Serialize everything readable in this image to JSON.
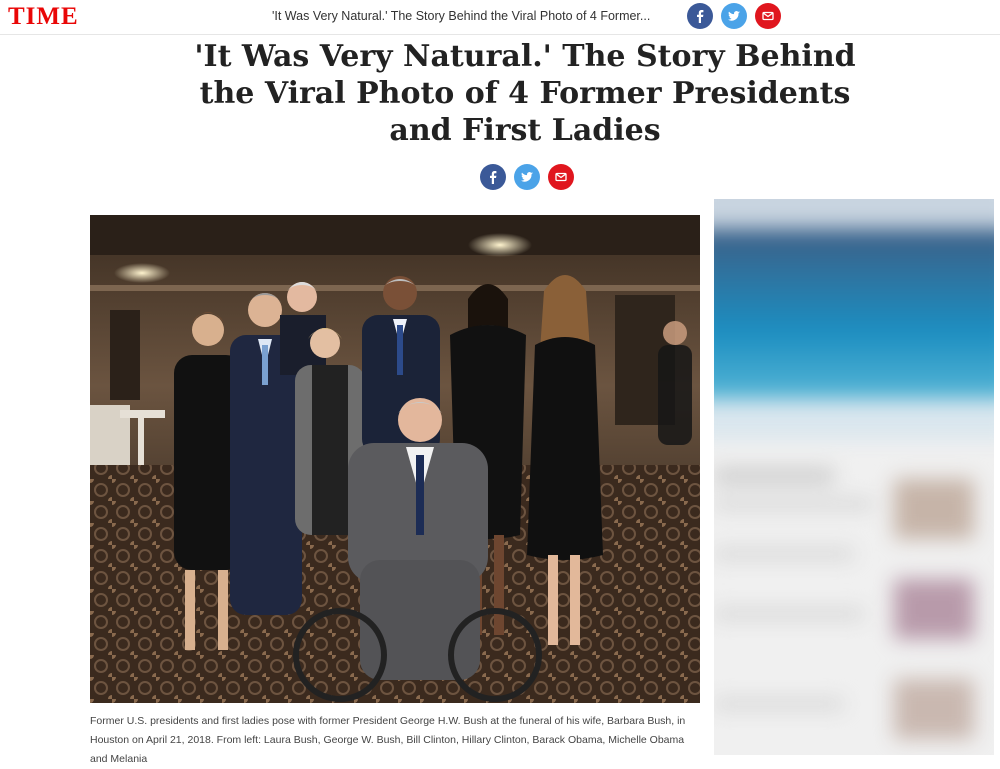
{
  "header": {
    "logo": "TIME",
    "headline": "'It Was Very Natural.' The Story Behind the Viral Photo of 4 Former..."
  },
  "share": {
    "facebook_icon": "facebook-icon",
    "twitter_icon": "twitter-icon",
    "email_icon": "email-icon",
    "colors": {
      "facebook": "#3b5998",
      "twitter": "#4ba3e8",
      "email": "#e0161e"
    }
  },
  "article": {
    "title": "'It Was Very Natural.' The Story Behind the Viral Photo of 4 Former Presidents and First Ladies",
    "caption": "Former U.S. presidents and first ladies pose with former President George H.W. Bush at the funeral of his wife, Barbara Bush, in Houston on April 21, 2018. From left: Laura Bush, George W. Bush, Bill Clinton, Hillary Clinton, Barack Obama, Michelle Obama and Melania"
  },
  "brand_color": "#e90606"
}
